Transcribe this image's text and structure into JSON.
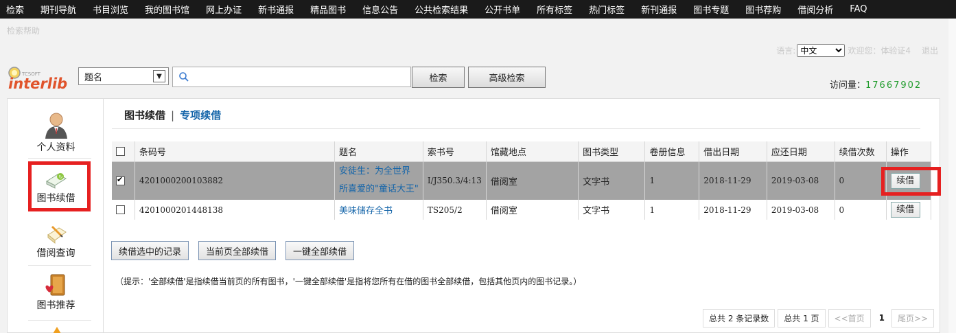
{
  "topnav": [
    "检索",
    "期刊导航",
    "书目浏览",
    "我的图书馆",
    "网上办证",
    "新书通报",
    "精品图书",
    "信息公告",
    "公共检索结果",
    "公开书单",
    "所有标签",
    "热门标签",
    "新刊通报",
    "图书专题",
    "图书荐购",
    "借阅分析",
    "FAQ"
  ],
  "subhelp": "检索帮助",
  "lang": {
    "label": "语言:",
    "value": "中文",
    "welcome": "欢迎您：体验证4",
    "logout": "退出"
  },
  "logo": {
    "small": "TCSOFT",
    "main": "interlib"
  },
  "search": {
    "field": "题名",
    "placeholder": "",
    "search_btn": "检索",
    "adv_btn": "高级检索"
  },
  "visits": {
    "label": "访问量：",
    "value": "17667902"
  },
  "sidebar": [
    {
      "label": "个人资料",
      "icon": "person-icon"
    },
    {
      "label": "图书续借",
      "icon": "book-renew-icon"
    },
    {
      "label": "借阅查询",
      "icon": "borrow-query-icon"
    },
    {
      "label": "图书推荐",
      "icon": "book-recommend-icon"
    }
  ],
  "tabs": {
    "active": "图书续借",
    "sep": "|",
    "other": "专项续借"
  },
  "table": {
    "headers": [
      "条码号",
      "题名",
      "索书号",
      "馆藏地点",
      "图书类型",
      "卷册信息",
      "借出日期",
      "应还日期",
      "续借次数",
      "操作"
    ],
    "rows": [
      {
        "checked": true,
        "barcode": "4201000200103882",
        "title_line1": "安徒生：为全世界",
        "title_line2": "所喜爱的\"童话大王\"",
        "callno": "I/J350.3/4:13",
        "location": "借阅室",
        "type": "文字书",
        "volume": "1",
        "out": "2018-11-29",
        "due": "2019-03-08",
        "renews": "0",
        "action": "续借"
      },
      {
        "checked": false,
        "barcode": "4201000201448138",
        "title": "美味储存全书",
        "callno": "TS205/2",
        "location": "借阅室",
        "type": "文字书",
        "volume": "1",
        "out": "2018-11-29",
        "due": "2019-03-08",
        "renews": "0",
        "action": "续借"
      }
    ]
  },
  "actions": [
    "续借选中的记录",
    "当前页全部续借",
    "一键全部续借"
  ],
  "hint": "（提示：'全部续借'是指续借当前页的所有图书，'一键全部续借'是指将您所有在借的图书全部续借，包括其他页内的图书记录。）",
  "pager": {
    "total": "总共 2 条记录数",
    "pages": "总共 1 页",
    "first": "<<首页",
    "current": "1",
    "last": "尾页>>"
  },
  "colors": {
    "nav_bg": "#1a1a1a",
    "highlight": "#e62020",
    "link": "#1565a9",
    "visits": "#1e9b2a",
    "selected_row": "#a3a3a3"
  }
}
